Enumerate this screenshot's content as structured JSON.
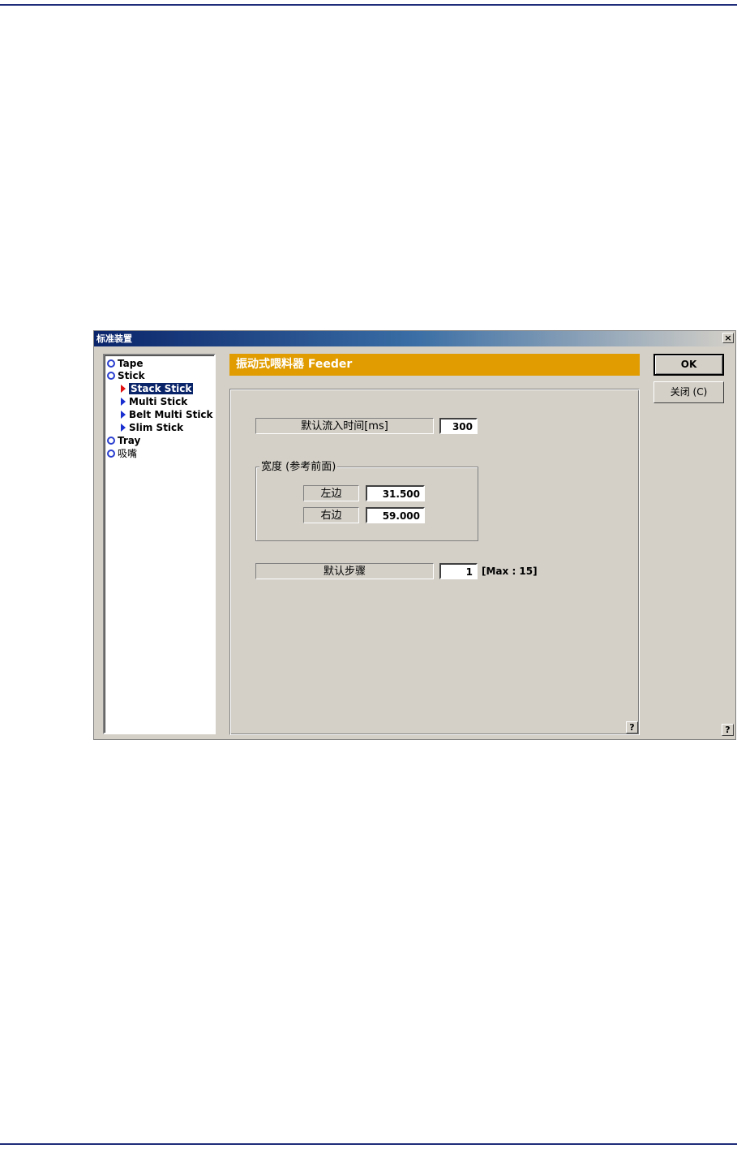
{
  "window": {
    "title": "标准装置",
    "close_glyph": "×"
  },
  "tree": {
    "items": [
      {
        "label": "Tape",
        "level": 0
      },
      {
        "label": "Stick",
        "level": 0
      },
      {
        "label": "Stack Stick",
        "level": 1,
        "selected": true
      },
      {
        "label": "Multi Stick",
        "level": 1
      },
      {
        "label": "Belt Multi Stick",
        "level": 1
      },
      {
        "label": "Slim Stick",
        "level": 1
      },
      {
        "label": "Tray",
        "level": 0
      },
      {
        "label": "吸嘴",
        "level": 0
      }
    ]
  },
  "header": {
    "title": "振动式喂料器 Feeder",
    "color": "#e09c00"
  },
  "buttons": {
    "ok": "OK",
    "close": "关闭 (C)"
  },
  "form": {
    "default_inflow_label": "默认流入时间[ms]",
    "default_inflow_value": "300",
    "width_group_title": "宽度 (参考前面)",
    "left_label": "左边",
    "left_value": "31.500",
    "right_label": "右边",
    "right_value": "59.000",
    "default_step_label": "默认步骤",
    "default_step_value": "1",
    "default_step_max": "[Max : 15]"
  },
  "help_glyph": "?"
}
